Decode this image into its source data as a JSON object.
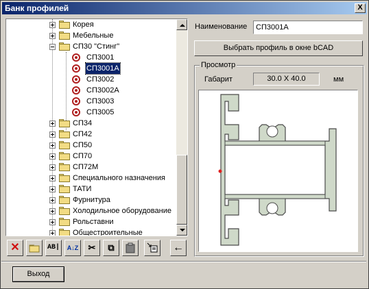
{
  "window": {
    "title": "Банк профилей",
    "close": "X"
  },
  "tree": {
    "items": [
      {
        "label": "Корея"
      },
      {
        "label": "Мебельные"
      },
      {
        "label": "СП30 \"Стинг\""
      },
      {
        "label": "СП3001"
      },
      {
        "label": "СП3001А"
      },
      {
        "label": "СП3002"
      },
      {
        "label": "СП3002А"
      },
      {
        "label": "СП3003"
      },
      {
        "label": "СП3005"
      },
      {
        "label": "СП34"
      },
      {
        "label": "СП42"
      },
      {
        "label": "СП50"
      },
      {
        "label": "СП70"
      },
      {
        "label": "СП72М"
      },
      {
        "label": "Специального назначения"
      },
      {
        "label": "ТАТИ"
      },
      {
        "label": "Фурнитура"
      },
      {
        "label": "Холодильное оборудование"
      },
      {
        "label": "Рольставни"
      },
      {
        "label": "Общестроительные"
      }
    ],
    "selected": "СП3001А"
  },
  "toolbar": {
    "delete": "✕",
    "new_folder": "",
    "rename": "AB|",
    "sort": "A↓Z",
    "cut": "✂",
    "copy": "⧉",
    "paste": "",
    "export": "",
    "back": "←"
  },
  "props": {
    "name_label": "Наименование",
    "name_value": "СП3001А",
    "select_button": "Выбрать профиль в окне bCAD",
    "preview_group": "Просмотр",
    "size_label": "Габарит",
    "size_value": "30.0 X 40.0",
    "unit": "мм"
  },
  "footer": {
    "exit_button": "Выход"
  },
  "colors": {
    "title_start": "#0a246a",
    "title_end": "#a6caf0",
    "selection": "#0a246a",
    "profile_fill": "#cfd9c9",
    "profile_stroke": "#4a4a4a",
    "marker": "#e02020"
  }
}
